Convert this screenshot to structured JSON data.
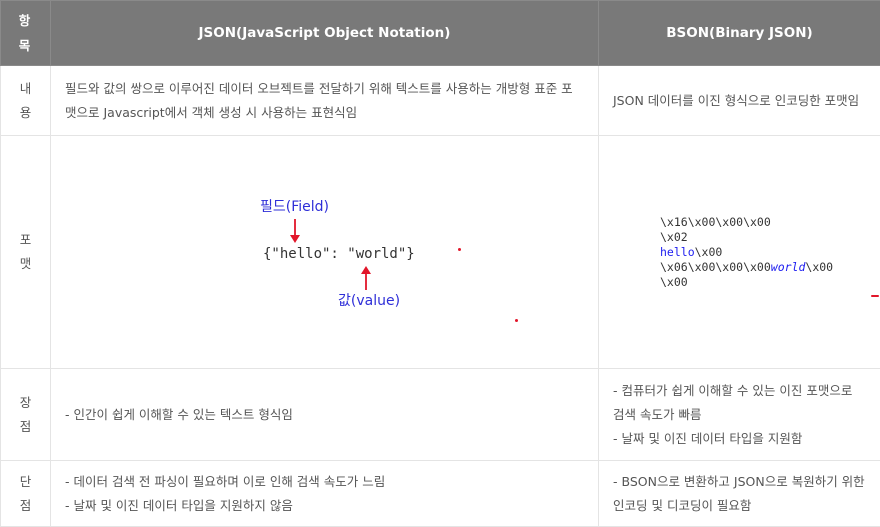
{
  "header": {
    "col1": [
      "항",
      "목"
    ],
    "col2": "JSON(JavaScript Object Notation)",
    "col3": "BSON(Binary JSON)"
  },
  "rows": {
    "content": {
      "label": [
        "내",
        "용"
      ],
      "json": "필드와 값의 쌍으로 이루어진 데이터 오브젝트를 전달하기 위해 텍스트를 사용하는 개방형 표준 포맷으로 Javascript에서 객체 생성 시 사용하는 표현식임",
      "bson": "JSON 데이터를 이진 형식으로 인코딩한 포맷임"
    },
    "format": {
      "label": [
        "포",
        "맷"
      ],
      "json": {
        "field_label": "필드(Field)",
        "code": "{\"hello\": \"world\"}",
        "value_label": "값(value)"
      },
      "bson": {
        "line1": "\\x16\\x00\\x00\\x00",
        "line2": "\\x02",
        "line3_kw": "hello",
        "line3_rest": "\\x00",
        "line4_pre": "\\x06\\x00\\x00\\x00",
        "line4_kw": "world",
        "line4_post": "\\x00",
        "line5": "\\x00"
      }
    },
    "pros": {
      "label": [
        "장",
        "점"
      ],
      "json": [
        "- 인간이 쉽게 이해할 수 있는 텍스트 형식임"
      ],
      "bson": [
        "- 컴퓨터가 쉽게 이해할 수 있는 이진 포맷으로 검색 속도가 빠름",
        "- 날짜 및 이진 데이터 타입을 지원함"
      ]
    },
    "cons": {
      "label": [
        "단",
        "점"
      ],
      "json": [
        "- 데이터 검색 전 파싱이 필요하며 이로 인해 검색 속도가 느림",
        "- 날짜 및 이진 데이터 타입을 지원하지 않음"
      ],
      "bson": [
        "- BSON으로 변환하고 JSON으로 복원하기 위한 인코딩 및 디코딩이 필요함"
      ]
    }
  },
  "colors": {
    "header_bg": "#797979",
    "arrow": "#e2162a",
    "keyword": "#2f2fd8"
  }
}
